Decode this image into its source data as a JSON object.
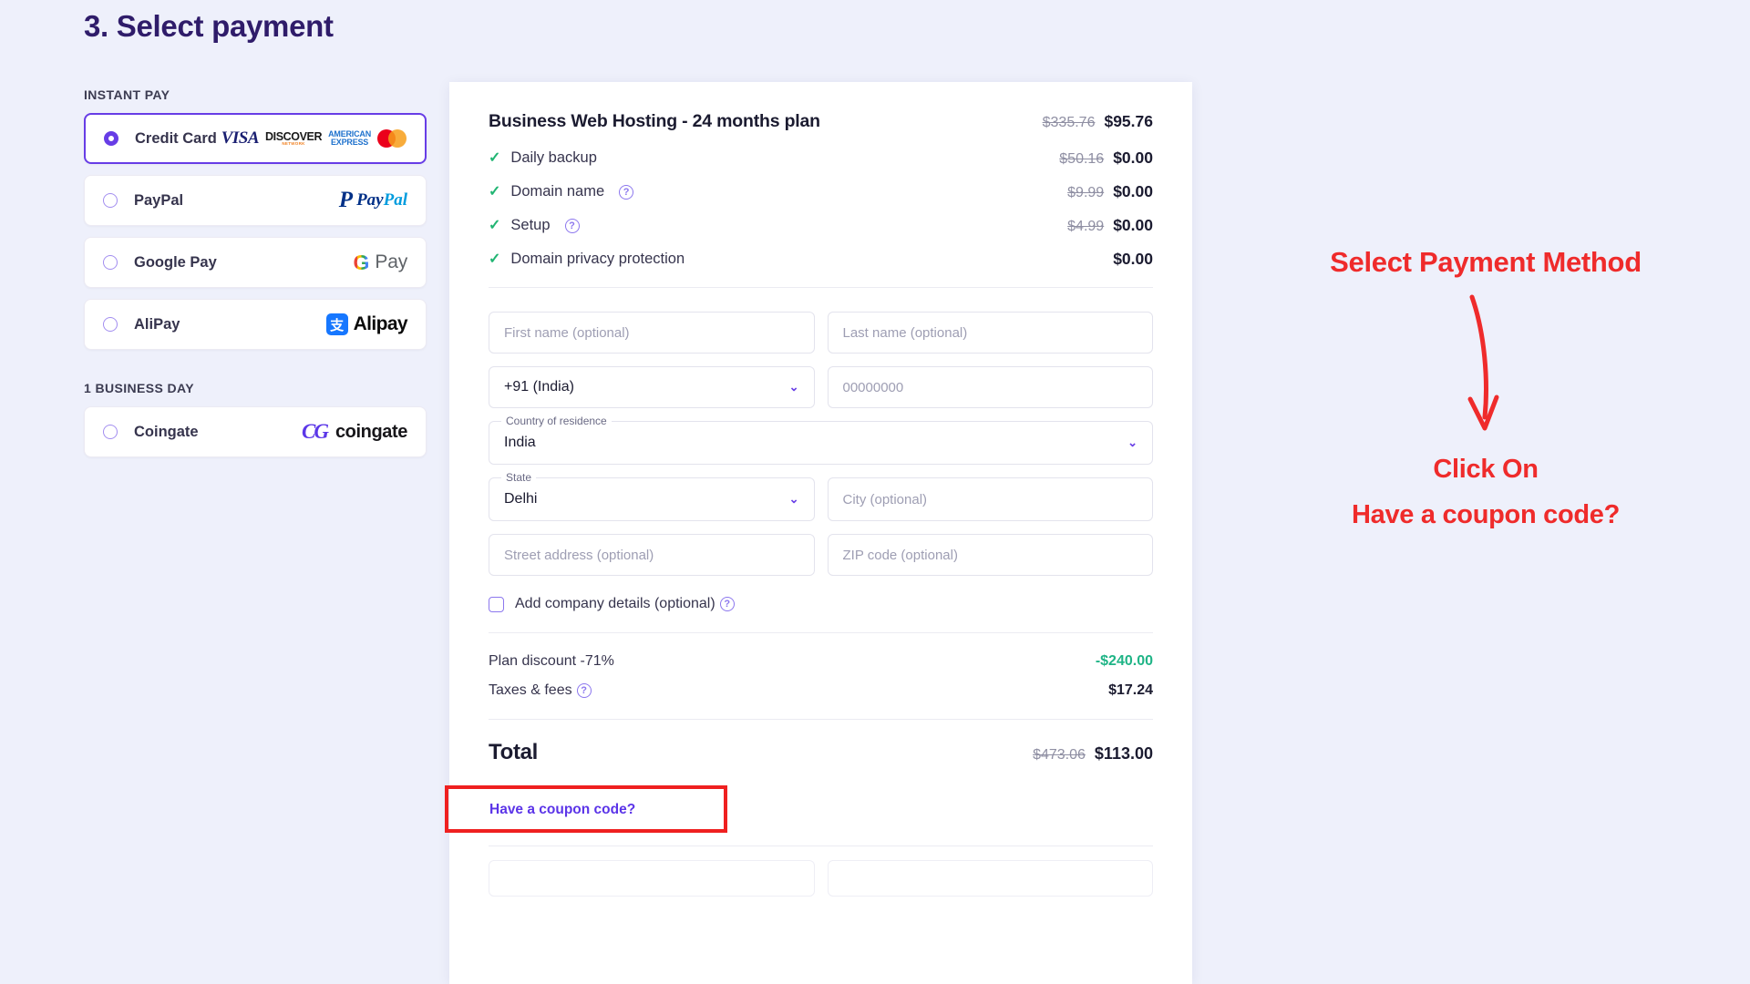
{
  "step": {
    "title": "3. Select payment"
  },
  "payment_groups": [
    {
      "label": "INSTANT PAY",
      "options": [
        {
          "name": "Credit Card",
          "selected": true,
          "logos": [
            "visa",
            "discover",
            "amex",
            "mastercard"
          ]
        },
        {
          "name": "PayPal",
          "selected": false,
          "logos": [
            "paypal"
          ]
        },
        {
          "name": "Google Pay",
          "selected": false,
          "logos": [
            "gpay"
          ]
        },
        {
          "name": "AliPay",
          "selected": false,
          "logos": [
            "alipay"
          ]
        }
      ]
    },
    {
      "label": "1 BUSINESS DAY",
      "options": [
        {
          "name": "Coingate",
          "selected": false,
          "logos": [
            "coingate"
          ]
        }
      ]
    }
  ],
  "logo_text": {
    "visa": "VISA",
    "discover_main": "DISCOVER",
    "discover_sub": "NETWORK",
    "amex_line1": "AMERICAN",
    "amex_line2": "EXPRESS",
    "paypal_mark": "P",
    "paypal_name_a": "Pay",
    "paypal_name_b": "Pal",
    "gpay_g": "G",
    "gpay_pay": "Pay",
    "alipay_glyph": "支",
    "alipay_name": "Alipay",
    "coingate_mark": "CG",
    "coingate_name": "coingate"
  },
  "order": {
    "plan_title": "Business Web Hosting - 24 months plan",
    "plan_price_old": "$335.76",
    "plan_price_new": "$95.76",
    "features": [
      {
        "label": "Daily backup",
        "info": false,
        "price_old": "$50.16",
        "price_new": "$0.00"
      },
      {
        "label": "Domain name",
        "info": true,
        "price_old": "$9.99",
        "price_new": "$0.00"
      },
      {
        "label": "Setup",
        "info": true,
        "price_old": "$4.99",
        "price_new": "$0.00"
      },
      {
        "label": "Domain privacy protection",
        "info": false,
        "price_old": "",
        "price_new": "$0.00"
      }
    ]
  },
  "form": {
    "first_name_placeholder": "First name (optional)",
    "last_name_placeholder": "Last name (optional)",
    "phone_code_value": "+91 (India)",
    "phone_placeholder": "00000000",
    "country_label": "Country of residence",
    "country_value": "India",
    "state_label": "State",
    "state_value": "Delhi",
    "city_placeholder": "City (optional)",
    "street_placeholder": "Street address (optional)",
    "zip_placeholder": "ZIP code (optional)",
    "company_checkbox_label": "Add company details (optional)"
  },
  "summary": {
    "discount_label": "Plan discount -71%",
    "discount_value": "-$240.00",
    "taxes_label": "Taxes & fees",
    "taxes_value": "$17.24",
    "total_label": "Total",
    "total_old": "$473.06",
    "total_new": "$113.00",
    "coupon_link": "Have a coupon code?"
  },
  "icons": {
    "check": "✓",
    "question": "?",
    "chevron": "⌄"
  },
  "annotation": {
    "title": "Select Payment Method",
    "sub_line1": "Click On",
    "sub_line2": "Have a coupon code?",
    "color": "#ef2b2b"
  },
  "colors": {
    "accent": "#673de6",
    "brand_dark": "#2f1c6a",
    "green": "#1fb486",
    "highlight": "#ef2020",
    "page_bg": "#eef0fb"
  }
}
